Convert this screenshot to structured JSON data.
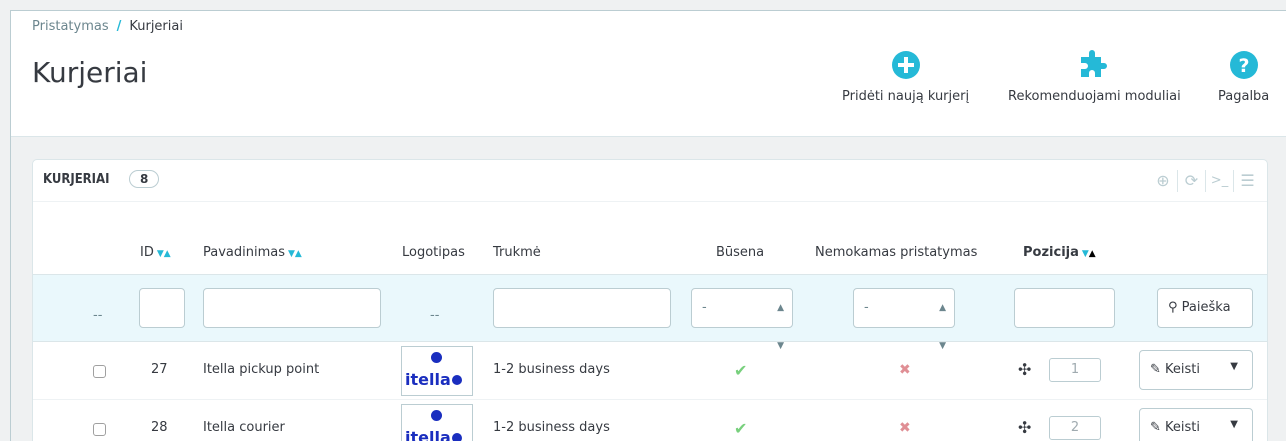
{
  "breadcrumb": {
    "parent": "Pristatymas",
    "separator": "/",
    "current": "Kurjeriai"
  },
  "page_title": "Kurjeriai",
  "toolbar": {
    "add_label": "Pridėti naują kurjerį",
    "modules_label": "Rekomenduojami moduliai",
    "help_label": "Pagalba",
    "accent": "#25b9d7"
  },
  "panel": {
    "title": "KURJERIAI",
    "count": "8"
  },
  "columns": {
    "id": "ID",
    "name": "Pavadinimas",
    "logo": "Logotipas",
    "delay": "Trukmė",
    "status": "Būsena",
    "free": "Nemokamas pristatymas",
    "position": "Pozicija"
  },
  "filters": {
    "dash": "--",
    "status_select": "-",
    "free_select": "-",
    "search_label": "Paieška"
  },
  "rows": [
    {
      "id": "27",
      "name": "Itella pickup point",
      "logo_text": "itella",
      "delay": "1-2 business days",
      "status": "enabled",
      "free": "no",
      "position": "1",
      "edit_label": "Keisti"
    },
    {
      "id": "28",
      "name": "Itella courier",
      "logo_text": "itella",
      "delay": "1-2 business days",
      "status": "enabled",
      "free": "no",
      "position": "2",
      "edit_label": "Keisti"
    }
  ]
}
